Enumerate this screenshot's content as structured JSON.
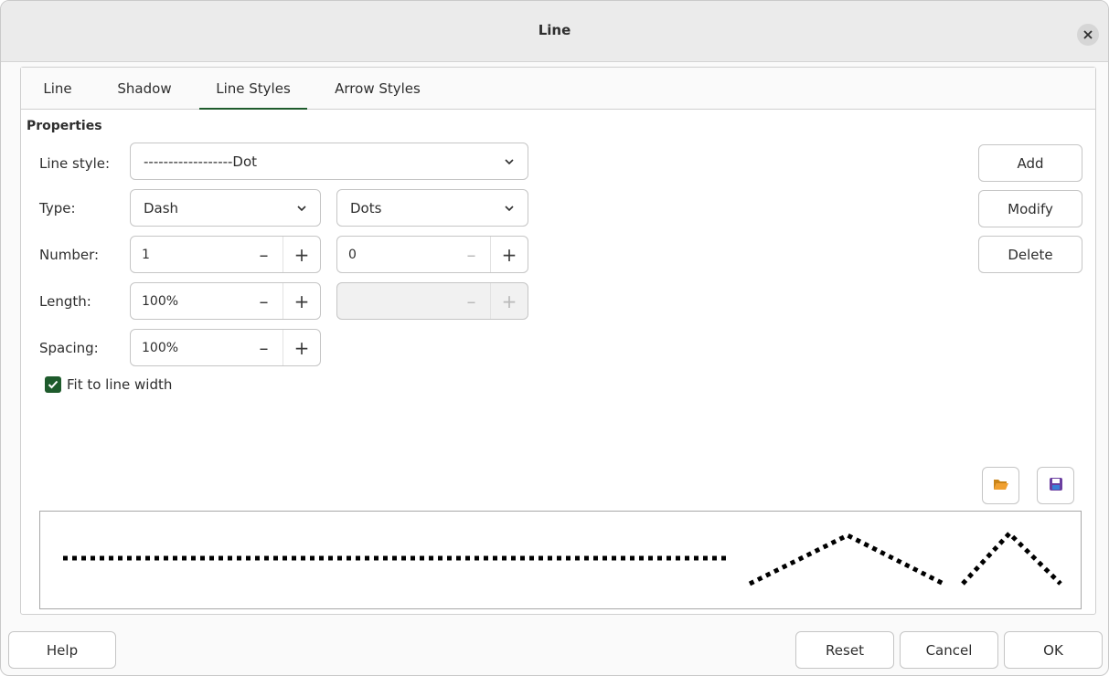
{
  "window": {
    "title": "Line"
  },
  "tabs": [
    {
      "label": "Line",
      "active": false
    },
    {
      "label": "Shadow",
      "active": false
    },
    {
      "label": "Line Styles",
      "active": true
    },
    {
      "label": "Arrow Styles",
      "active": false
    }
  ],
  "properties": {
    "section_title": "Properties",
    "line_style": {
      "label": "Line style:",
      "value": "------------------Dot"
    },
    "type": {
      "label": "Type:",
      "value1": "Dash",
      "value2": "Dots"
    },
    "number": {
      "label": "Number:",
      "value1": "1",
      "value2": "0"
    },
    "length": {
      "label": "Length:",
      "value1": "100%",
      "value2": ""
    },
    "spacing": {
      "label": "Spacing:",
      "value1": "100%"
    },
    "fit_to_line_width": {
      "label": "Fit to line width",
      "checked": true
    }
  },
  "side_buttons": {
    "add": "Add",
    "modify": "Modify",
    "delete": "Delete"
  },
  "icons": {
    "open": "folder-open-icon",
    "save": "save-icon"
  },
  "footer": {
    "help": "Help",
    "reset": "Reset",
    "cancel": "Cancel",
    "ok": "OK"
  },
  "colors": {
    "accent": "#1e5b2c",
    "folder": "#f0a030",
    "save": "#6b3fa0"
  }
}
